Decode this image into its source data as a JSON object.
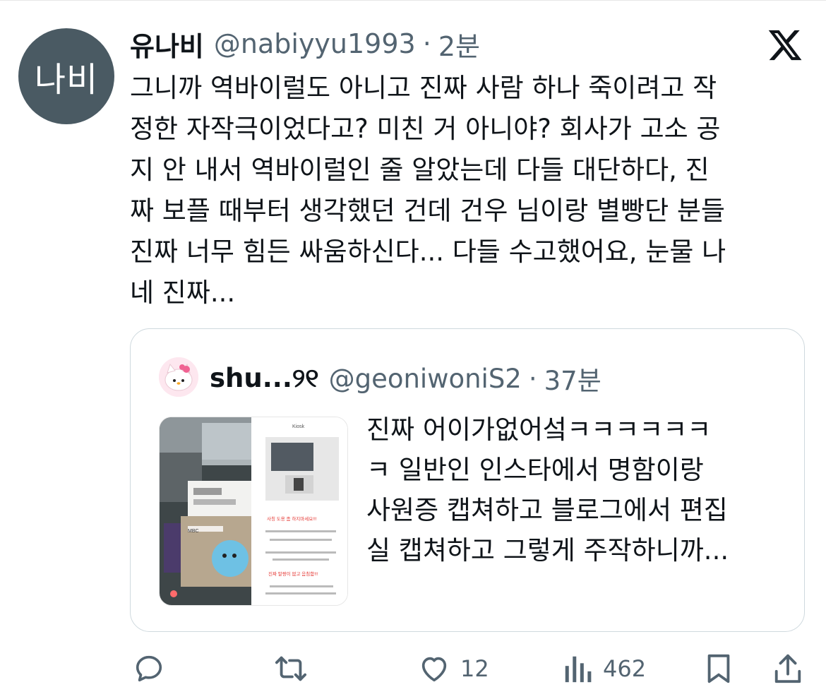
{
  "author": {
    "avatar_text": "나비",
    "name": "유나비",
    "handle": "@nabiyyu1993",
    "separator": "·",
    "time": "2분"
  },
  "tweet": {
    "text": "그니까 역바이럴도 아니고 진짜 사람 하나 죽이려고 작\n정한 자작극이었다고? 미친 거 아니야? 회사가 고소 공\n지 안 내서 역바이럴인 줄 알았는데 다들 대단하다, 진\n짜 보플 때부터 생각했던 건데 건우 님이랑 별빵단 분들\n진짜 너무 힘든 싸움하신다... 다들 수고했어요, 눈물 나\n네 진짜..."
  },
  "quoted": {
    "name": "shu...୨୧",
    "handle": "@geoniwoniS2",
    "separator": "·",
    "time": "37분",
    "text": "진짜 어이가없어섴ㅋㅋㅋㅋㅋㅋ\nㅋ 일반인 인스타에서 명함이랑\n사원증 캡쳐하고 블로그에서 편집\n실 캡쳐하고 그렇게 주작하니까...",
    "image": {
      "card_brand": "MBC",
      "phone_header": "Kiosk",
      "phone_red_title": "사칭 도용 좀 하지마세요!!!",
      "phone_red_sub": "진짜 말짱이 없고 음침함!!!"
    }
  },
  "actions": {
    "replies_count": "",
    "retweets_count": "",
    "likes_count": "12",
    "views_count": "462"
  },
  "colors": {
    "text": "#0f1419",
    "muted": "#536471",
    "border": "#cfd9de",
    "avatar_bg": "#4a5a63"
  }
}
